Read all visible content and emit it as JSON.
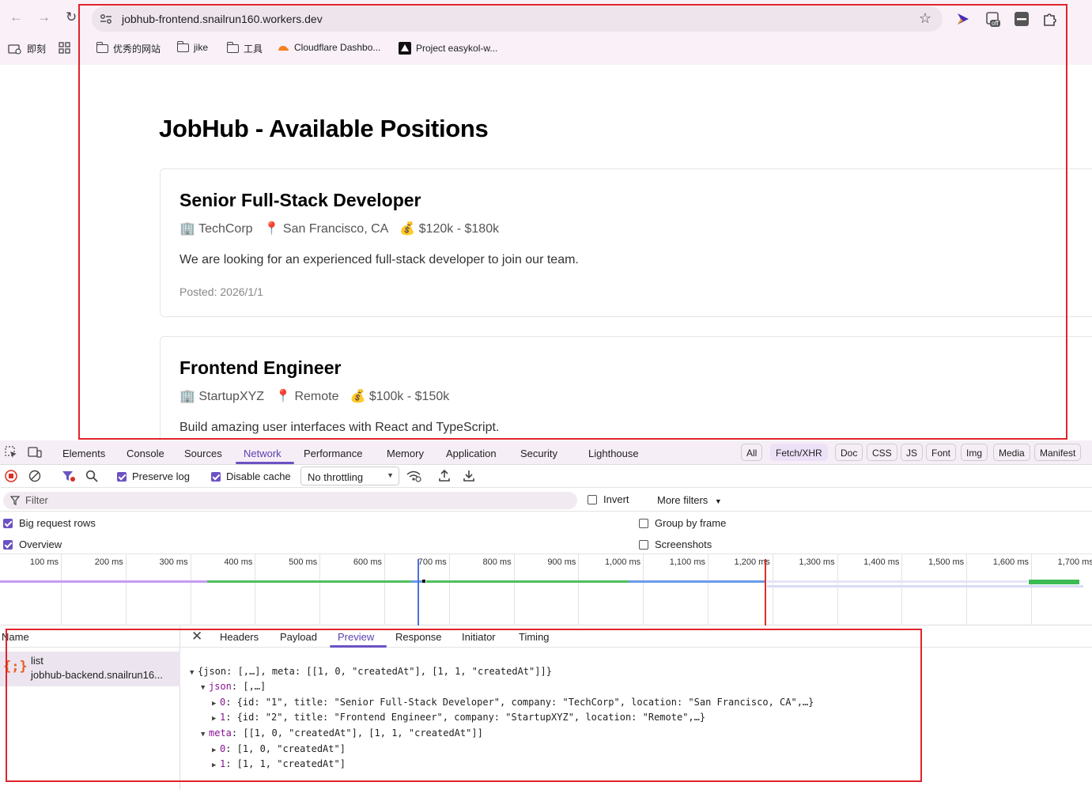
{
  "browser": {
    "url": "jobhub-frontend.snailrun160.workers.dev",
    "ext_badge": "off",
    "bookmarks": [
      {
        "label": "即刻",
        "icon": "bookmark-manager-icon"
      },
      {
        "label": "",
        "icon": "apps-grid-icon"
      },
      {
        "label": "优秀的网站",
        "icon": "folder-icon"
      },
      {
        "label": "jike",
        "icon": "folder-icon"
      },
      {
        "label": "工具",
        "icon": "folder-icon"
      },
      {
        "label": "Cloudflare Dashbo...",
        "icon": "cloudflare-icon"
      },
      {
        "label": "Project easykol-w...",
        "icon": "vercel-icon"
      }
    ]
  },
  "page": {
    "heading": "JobHub - Available Positions",
    "jobs": [
      {
        "title": "Senior Full-Stack Developer",
        "company": "🏢 TechCorp",
        "location": "📍 San Francisco, CA",
        "salary": "💰 $120k - $180k",
        "description": "We are looking for an experienced full-stack developer to join our team.",
        "posted": "Posted: 2026/1/1"
      },
      {
        "title": "Frontend Engineer",
        "company": "🏢 StartupXYZ",
        "location": "📍 Remote",
        "salary": "💰 $100k - $150k",
        "description": "Build amazing user interfaces with React and TypeScript."
      }
    ]
  },
  "devtools": {
    "tabs": [
      "Elements",
      "Console",
      "Sources",
      "Network",
      "Performance",
      "Memory",
      "Application",
      "Security",
      "Lighthouse"
    ],
    "active_tab": "Network",
    "toolbar": {
      "preserve_log": "Preserve log",
      "disable_cache": "Disable cache",
      "throttling": "No throttling"
    },
    "filter": {
      "placeholder": "Filter",
      "invert": "Invert",
      "more_filters": "More filters",
      "types": [
        "All",
        "Fetch/XHR",
        "Doc",
        "CSS",
        "JS",
        "Font",
        "Img",
        "Media",
        "Manifest"
      ],
      "active_type": "Fetch/XHR"
    },
    "options": {
      "big_request_rows": "Big request rows",
      "overview": "Overview",
      "group_by_frame": "Group by frame",
      "screenshots": "Screenshots"
    },
    "timeline_ticks": [
      "100 ms",
      "200 ms",
      "300 ms",
      "400 ms",
      "500 ms",
      "600 ms",
      "700 ms",
      "800 ms",
      "900 ms",
      "1,000 ms",
      "1,100 ms",
      "1,200 ms",
      "1,300 ms",
      "1,400 ms",
      "1,500 ms",
      "1,600 ms",
      "1,700 ms"
    ],
    "requests": {
      "header": "Name",
      "items": [
        {
          "name": "list",
          "host": "jobhub-backend.snailrun16..."
        }
      ]
    },
    "detail_tabs": [
      "Headers",
      "Payload",
      "Preview",
      "Response",
      "Initiator",
      "Timing"
    ],
    "active_detail_tab": "Preview",
    "preview_lines": {
      "root": "{json: [,…], meta: [[1, 0, \"createdAt\"], [1, 1, \"createdAt\"]]}",
      "json_key": "json",
      "json_val": ": [,…]",
      "item0_key": "0",
      "item0_val": ": {id: \"1\", title: \"Senior Full-Stack Developer\", company: \"TechCorp\", location: \"San Francisco, CA\",…}",
      "item1_key": "1",
      "item1_val": ": {id: \"2\", title: \"Frontend Engineer\", company: \"StartupXYZ\", location: \"Remote\",…}",
      "meta_key": "meta",
      "meta_val": ": [[1, 0, \"createdAt\"], [1, 1, \"createdAt\"]]",
      "meta0_key": "0",
      "meta0_val": ": [1, 0, \"createdAt\"]",
      "meta1_key": "1",
      "meta1_val": ": [1, 1, \"createdAt\"]"
    }
  },
  "colors": {
    "accent": "#6c52c4",
    "highlight_box": "#e0242a"
  }
}
